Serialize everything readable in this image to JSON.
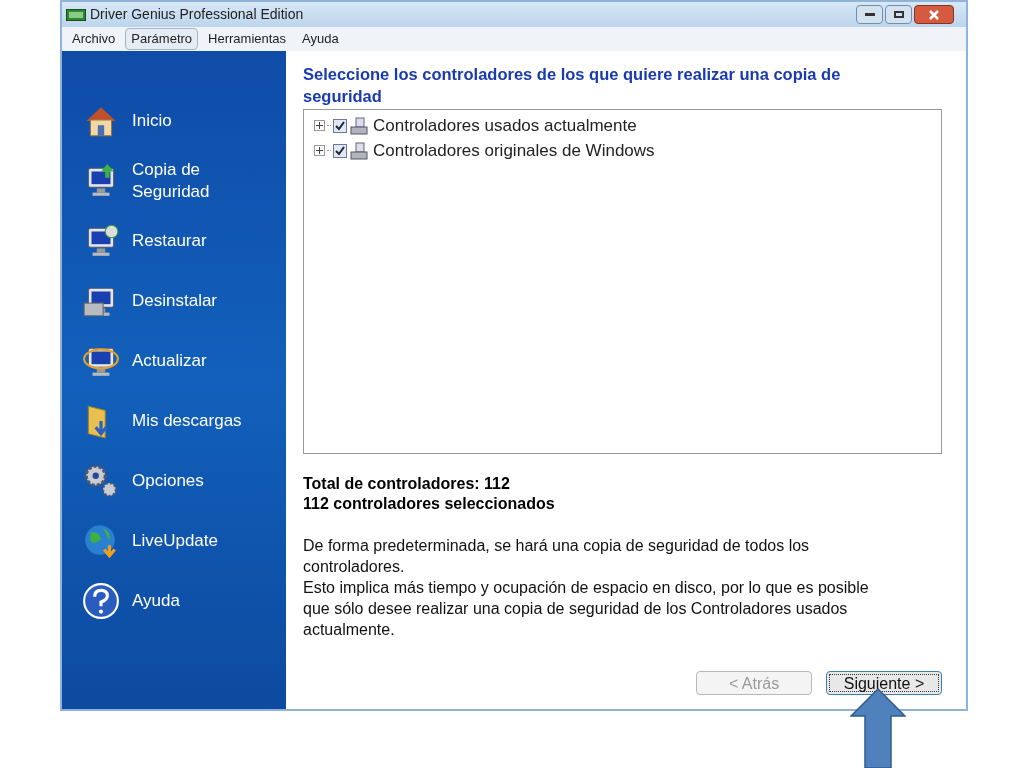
{
  "window": {
    "title": "Driver Genius Professional Edition"
  },
  "menu": [
    {
      "label": "Archivo",
      "selected": false
    },
    {
      "label": "Parámetro",
      "selected": true
    },
    {
      "label": "Herramientas",
      "selected": false
    },
    {
      "label": "Ayuda",
      "selected": false
    }
  ],
  "sidebar": {
    "items": [
      {
        "label": "Inicio"
      },
      {
        "label": "Copia de Seguridad"
      },
      {
        "label": "Restaurar"
      },
      {
        "label": "Desinstalar"
      },
      {
        "label": "Actualizar"
      },
      {
        "label": "Mis descargas"
      },
      {
        "label": "Opciones"
      },
      {
        "label": "LiveUpdate"
      },
      {
        "label": "Ayuda"
      }
    ]
  },
  "content": {
    "heading": "Seleccione los controladores de los que quiere realizar una copia de seguridad",
    "tree": [
      {
        "label": "Controladores usados actualmente",
        "checked": true,
        "expanded": false
      },
      {
        "label": "Controladores originales de Windows",
        "checked": true,
        "expanded": false
      }
    ],
    "total": "Total de controladores: 112",
    "selected_count": "112 controladores seleccionados",
    "description": [
      "De forma predeterminada, se hará una copia de seguridad de todos los controladores.",
      "Esto implica más tiempo y ocupación de espacio en disco, por lo que es posible que sólo desee realizar una copia de seguridad de los Controladores usados actualmente."
    ]
  },
  "buttons": [
    {
      "label": "< Atrás",
      "disabled": true
    },
    {
      "label": "Siguiente >",
      "disabled": false
    }
  ]
}
